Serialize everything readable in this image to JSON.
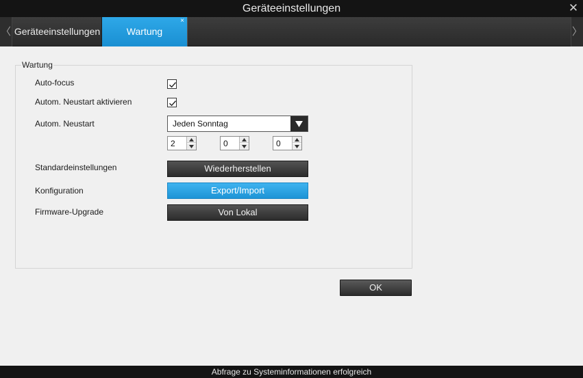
{
  "window": {
    "title": "Geräteeinstellungen",
    "close_icon": "close-icon"
  },
  "tabs": {
    "prev_icon": "chevron-left-icon",
    "next_icon": "chevron-right-icon",
    "items": [
      {
        "label": "Geräteeinstellungen",
        "active": false
      },
      {
        "label": "Wartung",
        "active": true,
        "close_glyph": "×"
      }
    ]
  },
  "maintenance": {
    "group_title": "Wartung",
    "autofocus": {
      "label": "Auto-focus",
      "checked": true
    },
    "auto_restart_enable": {
      "label": "Autom. Neustart aktivieren",
      "checked": true
    },
    "auto_restart": {
      "label": "Autom. Neustart",
      "schedule_value": "Jeden Sonntag",
      "time": [
        "2",
        "0",
        "0"
      ]
    },
    "defaults": {
      "label": "Standardeinstellungen",
      "button": "Wiederherstellen"
    },
    "config": {
      "label": "Konfiguration",
      "button": "Export/Import"
    },
    "firmware": {
      "label": "Firmware-Upgrade",
      "button": "Von Lokal"
    }
  },
  "ok_label": "OK",
  "status_text": "Abfrage zu Systeminformationen erfolgreich",
  "colors": {
    "accent": "#1d94d6",
    "titlebar": "#141414",
    "panel": "#f0f0f0"
  }
}
